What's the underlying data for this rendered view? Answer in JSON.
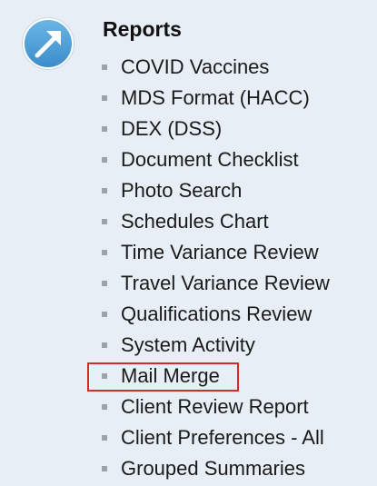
{
  "section": {
    "title": "Reports",
    "icon": "arrow-up-right-icon",
    "icon_color": "#4a9fd6",
    "highlight_color": "#d62a2a"
  },
  "reports": [
    {
      "label": "COVID Vaccines"
    },
    {
      "label": "MDS Format (HACC)"
    },
    {
      "label": "DEX (DSS)"
    },
    {
      "label": "Document Checklist"
    },
    {
      "label": "Photo Search"
    },
    {
      "label": "Schedules Chart"
    },
    {
      "label": "Time Variance Review"
    },
    {
      "label": "Travel Variance Review"
    },
    {
      "label": "Qualifications Review"
    },
    {
      "label": "System Activity"
    },
    {
      "label": "Mail Merge"
    },
    {
      "label": "Client Review Report"
    },
    {
      "label": "Client Preferences - All"
    },
    {
      "label": "Grouped Summaries"
    }
  ]
}
